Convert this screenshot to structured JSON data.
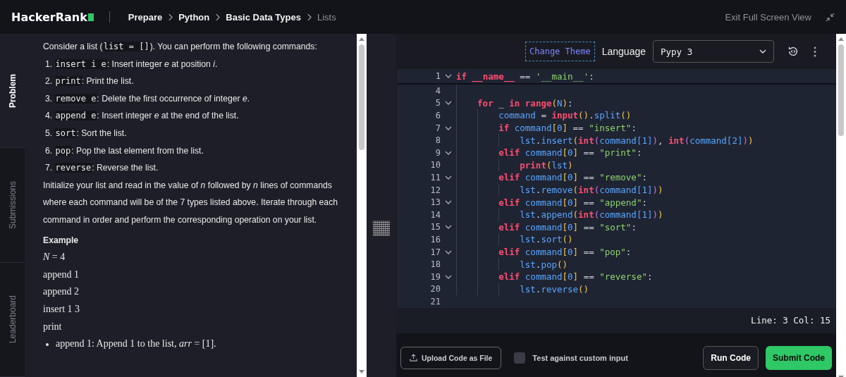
{
  "header": {
    "logo": "HackerRank",
    "breadcrumbs": [
      {
        "label": "Prepare",
        "current": false
      },
      {
        "label": "Python",
        "current": false
      },
      {
        "label": "Basic Data Types",
        "current": false
      },
      {
        "label": "Lists",
        "current": true
      }
    ],
    "exit_label": "Exit Full Screen View"
  },
  "side_tabs": [
    {
      "label": "Problem",
      "selected": true
    },
    {
      "label": "Submissions",
      "selected": false
    },
    {
      "label": "Leaderboard",
      "selected": false
    }
  ],
  "problem": {
    "intro": [
      {
        "kind": "text",
        "text": "Consider a list ("
      },
      {
        "kind": "code",
        "text": "list = []"
      },
      {
        "kind": "text",
        "text": "). You can perform the following commands:"
      }
    ],
    "commands": [
      {
        "number": "1.",
        "code": "insert i e",
        "text": ": Insert integer *e* at position *i*."
      },
      {
        "number": "2.",
        "code": "print",
        "text": ": Print the list."
      },
      {
        "number": "3.",
        "code": "remove e",
        "text": ": Delete the first occurrence of integer *e*."
      },
      {
        "number": "4.",
        "code": "append e",
        "text": ": Insert integer *e* at the end of the list."
      },
      {
        "number": "5.",
        "code": "sort",
        "text": ": Sort the list."
      },
      {
        "number": "6.",
        "code": "pop",
        "text": ": Pop the last element from the list."
      },
      {
        "number": "7.",
        "code": "reverse",
        "text": ": Reverse the list."
      }
    ],
    "description": "Initialize your list and read in the value of *n* followed by *n* lines of commands where each command will be of the 7 types listed above. Iterate through each command in order and perform the corresponding operation on your list.",
    "example_heading": "Example",
    "example_lines": [
      "*N* = 4",
      "append 1",
      "append 2",
      "insert 1 3",
      "print"
    ],
    "bullets": [
      "append 1: Append 1 to the list, *arr* = [1]."
    ]
  },
  "editor": {
    "change_theme": "Change Theme",
    "language_label": "Language",
    "language": "Pypy 3",
    "lines": [
      {
        "number": "1",
        "sticky": true,
        "tokens": [
          {
            "kind": "kw",
            "text": "if "
          },
          {
            "kind": "kw",
            "text": "__name__"
          },
          {
            "kind": "p",
            "text": " == "
          },
          {
            "kind": "str",
            "text": "'__main__'"
          },
          {
            "kind": "p",
            "text": ":"
          }
        ],
        "children": [
          {
            "number": "4"
          },
          {
            "number": "5",
            "tokens": [
              {
                "kind": "kw",
                "text": "for"
              },
              {
                "kind": "p",
                "text": " _ "
              },
              {
                "kind": "kw",
                "text": "in "
              },
              {
                "kind": "kw",
                "text": "range"
              },
              {
                "kind": "b1",
                "text": "("
              },
              {
                "kind": "id",
                "text": "N"
              },
              {
                "kind": "b1",
                "text": ")"
              },
              {
                "kind": "p",
                "text": ":"
              }
            ],
            "children": [
              {
                "number": "6",
                "tokens": [
                  {
                    "kind": "id",
                    "text": "command"
                  },
                  {
                    "kind": "p",
                    "text": " = "
                  },
                  {
                    "kind": "kw",
                    "text": "input"
                  },
                  {
                    "kind": "b1",
                    "text": "()"
                  },
                  {
                    "kind": "p",
                    "text": "."
                  },
                  {
                    "kind": "id",
                    "text": "split"
                  },
                  {
                    "kind": "b1",
                    "text": "()"
                  }
                ]
              },
              {
                "number": "7",
                "tokens": [
                  {
                    "kind": "kw",
                    "text": "if "
                  },
                  {
                    "kind": "id",
                    "text": "command"
                  },
                  {
                    "kind": "b1",
                    "text": "["
                  },
                  {
                    "kind": "num",
                    "text": "0"
                  },
                  {
                    "kind": "b1",
                    "text": "]"
                  },
                  {
                    "kind": "p",
                    "text": " == "
                  },
                  {
                    "kind": "str",
                    "text": "\"insert\""
                  },
                  {
                    "kind": "p",
                    "text": ":"
                  }
                ],
                "children": [
                  {
                    "number": "8",
                    "tokens": [
                      {
                        "kind": "id",
                        "text": "lst"
                      },
                      {
                        "kind": "p",
                        "text": "."
                      },
                      {
                        "kind": "id",
                        "text": "insert"
                      },
                      {
                        "kind": "b1",
                        "text": "("
                      },
                      {
                        "kind": "kw",
                        "text": "int"
                      },
                      {
                        "kind": "b2",
                        "text": "("
                      },
                      {
                        "kind": "id",
                        "text": "command"
                      },
                      {
                        "kind": "b3",
                        "text": "["
                      },
                      {
                        "kind": "num",
                        "text": "1"
                      },
                      {
                        "kind": "b3",
                        "text": "]"
                      },
                      {
                        "kind": "b2",
                        "text": ")"
                      },
                      {
                        "kind": "p",
                        "text": ", "
                      },
                      {
                        "kind": "kw",
                        "text": "int"
                      },
                      {
                        "kind": "b2",
                        "text": "("
                      },
                      {
                        "kind": "id",
                        "text": "command"
                      },
                      {
                        "kind": "b3",
                        "text": "["
                      },
                      {
                        "kind": "num",
                        "text": "2"
                      },
                      {
                        "kind": "b3",
                        "text": "]"
                      },
                      {
                        "kind": "b2",
                        "text": ")"
                      },
                      {
                        "kind": "b1",
                        "text": ")"
                      }
                    ]
                  }
                ]
              },
              {
                "number": "9",
                "tokens": [
                  {
                    "kind": "kw",
                    "text": "elif "
                  },
                  {
                    "kind": "id",
                    "text": "command"
                  },
                  {
                    "kind": "b1",
                    "text": "["
                  },
                  {
                    "kind": "num",
                    "text": "0"
                  },
                  {
                    "kind": "b1",
                    "text": "]"
                  },
                  {
                    "kind": "p",
                    "text": " == "
                  },
                  {
                    "kind": "str",
                    "text": "\"print\""
                  },
                  {
                    "kind": "p",
                    "text": ":"
                  }
                ],
                "children": [
                  {
                    "number": "10",
                    "tokens": [
                      {
                        "kind": "kw",
                        "text": "print"
                      },
                      {
                        "kind": "b1",
                        "text": "("
                      },
                      {
                        "kind": "id",
                        "text": "lst"
                      },
                      {
                        "kind": "b1",
                        "text": ")"
                      }
                    ]
                  }
                ]
              },
              {
                "number": "11",
                "tokens": [
                  {
                    "kind": "kw",
                    "text": "elif "
                  },
                  {
                    "kind": "id",
                    "text": "command"
                  },
                  {
                    "kind": "b1",
                    "text": "["
                  },
                  {
                    "kind": "num",
                    "text": "0"
                  },
                  {
                    "kind": "b1",
                    "text": "]"
                  },
                  {
                    "kind": "p",
                    "text": " == "
                  },
                  {
                    "kind": "str",
                    "text": "\"remove\""
                  },
                  {
                    "kind": "p",
                    "text": ":"
                  }
                ],
                "children": [
                  {
                    "number": "12",
                    "tokens": [
                      {
                        "kind": "id",
                        "text": "lst"
                      },
                      {
                        "kind": "p",
                        "text": "."
                      },
                      {
                        "kind": "id",
                        "text": "remove"
                      },
                      {
                        "kind": "b1",
                        "text": "("
                      },
                      {
                        "kind": "kw",
                        "text": "int"
                      },
                      {
                        "kind": "b2",
                        "text": "("
                      },
                      {
                        "kind": "id",
                        "text": "command"
                      },
                      {
                        "kind": "b3",
                        "text": "["
                      },
                      {
                        "kind": "num",
                        "text": "1"
                      },
                      {
                        "kind": "b3",
                        "text": "]"
                      },
                      {
                        "kind": "b2",
                        "text": ")"
                      },
                      {
                        "kind": "b1",
                        "text": ")"
                      }
                    ]
                  }
                ]
              },
              {
                "number": "13",
                "tokens": [
                  {
                    "kind": "kw",
                    "text": "elif "
                  },
                  {
                    "kind": "id",
                    "text": "command"
                  },
                  {
                    "kind": "b1",
                    "text": "["
                  },
                  {
                    "kind": "num",
                    "text": "0"
                  },
                  {
                    "kind": "b1",
                    "text": "]"
                  },
                  {
                    "kind": "p",
                    "text": " == "
                  },
                  {
                    "kind": "str",
                    "text": "\"append\""
                  },
                  {
                    "kind": "p",
                    "text": ":"
                  }
                ],
                "children": [
                  {
                    "number": "14",
                    "tokens": [
                      {
                        "kind": "id",
                        "text": "lst"
                      },
                      {
                        "kind": "p",
                        "text": "."
                      },
                      {
                        "kind": "id",
                        "text": "append"
                      },
                      {
                        "kind": "b1",
                        "text": "("
                      },
                      {
                        "kind": "kw",
                        "text": "int"
                      },
                      {
                        "kind": "b2",
                        "text": "("
                      },
                      {
                        "kind": "id",
                        "text": "command"
                      },
                      {
                        "kind": "b3",
                        "text": "["
                      },
                      {
                        "kind": "num",
                        "text": "1"
                      },
                      {
                        "kind": "b3",
                        "text": "]"
                      },
                      {
                        "kind": "b2",
                        "text": ")"
                      },
                      {
                        "kind": "b1",
                        "text": ")"
                      }
                    ]
                  }
                ]
              },
              {
                "number": "15",
                "tokens": [
                  {
                    "kind": "kw",
                    "text": "elif "
                  },
                  {
                    "kind": "id",
                    "text": "command"
                  },
                  {
                    "kind": "b1",
                    "text": "["
                  },
                  {
                    "kind": "num",
                    "text": "0"
                  },
                  {
                    "kind": "b1",
                    "text": "]"
                  },
                  {
                    "kind": "p",
                    "text": " == "
                  },
                  {
                    "kind": "str",
                    "text": "\"sort\""
                  },
                  {
                    "kind": "p",
                    "text": ":"
                  }
                ],
                "children": [
                  {
                    "number": "16",
                    "tokens": [
                      {
                        "kind": "id",
                        "text": "lst"
                      },
                      {
                        "kind": "p",
                        "text": "."
                      },
                      {
                        "kind": "id",
                        "text": "sort"
                      },
                      {
                        "kind": "b1",
                        "text": "()"
                      }
                    ]
                  }
                ]
              },
              {
                "number": "17",
                "tokens": [
                  {
                    "kind": "kw",
                    "text": "elif "
                  },
                  {
                    "kind": "id",
                    "text": "command"
                  },
                  {
                    "kind": "b1",
                    "text": "["
                  },
                  {
                    "kind": "num",
                    "text": "0"
                  },
                  {
                    "kind": "b1",
                    "text": "]"
                  },
                  {
                    "kind": "p",
                    "text": " == "
                  },
                  {
                    "kind": "str",
                    "text": "\"pop\""
                  },
                  {
                    "kind": "p",
                    "text": ":"
                  }
                ],
                "children": [
                  {
                    "number": "18",
                    "tokens": [
                      {
                        "kind": "id",
                        "text": "lst"
                      },
                      {
                        "kind": "p",
                        "text": "."
                      },
                      {
                        "kind": "id",
                        "text": "pop"
                      },
                      {
                        "kind": "b1",
                        "text": "()"
                      }
                    ]
                  }
                ]
              },
              {
                "number": "19",
                "tokens": [
                  {
                    "kind": "kw",
                    "text": "elif "
                  },
                  {
                    "kind": "id",
                    "text": "command"
                  },
                  {
                    "kind": "b1",
                    "text": "["
                  },
                  {
                    "kind": "num",
                    "text": "0"
                  },
                  {
                    "kind": "b1",
                    "text": "]"
                  },
                  {
                    "kind": "p",
                    "text": " == "
                  },
                  {
                    "kind": "str",
                    "text": "\"reverse\""
                  },
                  {
                    "kind": "p",
                    "text": ":"
                  }
                ],
                "children": [
                  {
                    "number": "20",
                    "tokens": [
                      {
                        "kind": "id",
                        "text": "lst"
                      },
                      {
                        "kind": "p",
                        "text": "."
                      },
                      {
                        "kind": "id",
                        "text": "reverse"
                      },
                      {
                        "kind": "b1",
                        "text": "()"
                      }
                    ]
                  }
                ]
              }
            ]
          }
        ]
      },
      {
        "number": "21",
        "sticky": false
      }
    ],
    "cursor_status": "Line: 3 Col: 15"
  },
  "footer": {
    "upload_label": "Upload Code as File",
    "custom_input": {
      "label": "Test against custom input",
      "checked": false
    },
    "run_label": "Run Code",
    "submit_label": "Submit Code"
  }
}
